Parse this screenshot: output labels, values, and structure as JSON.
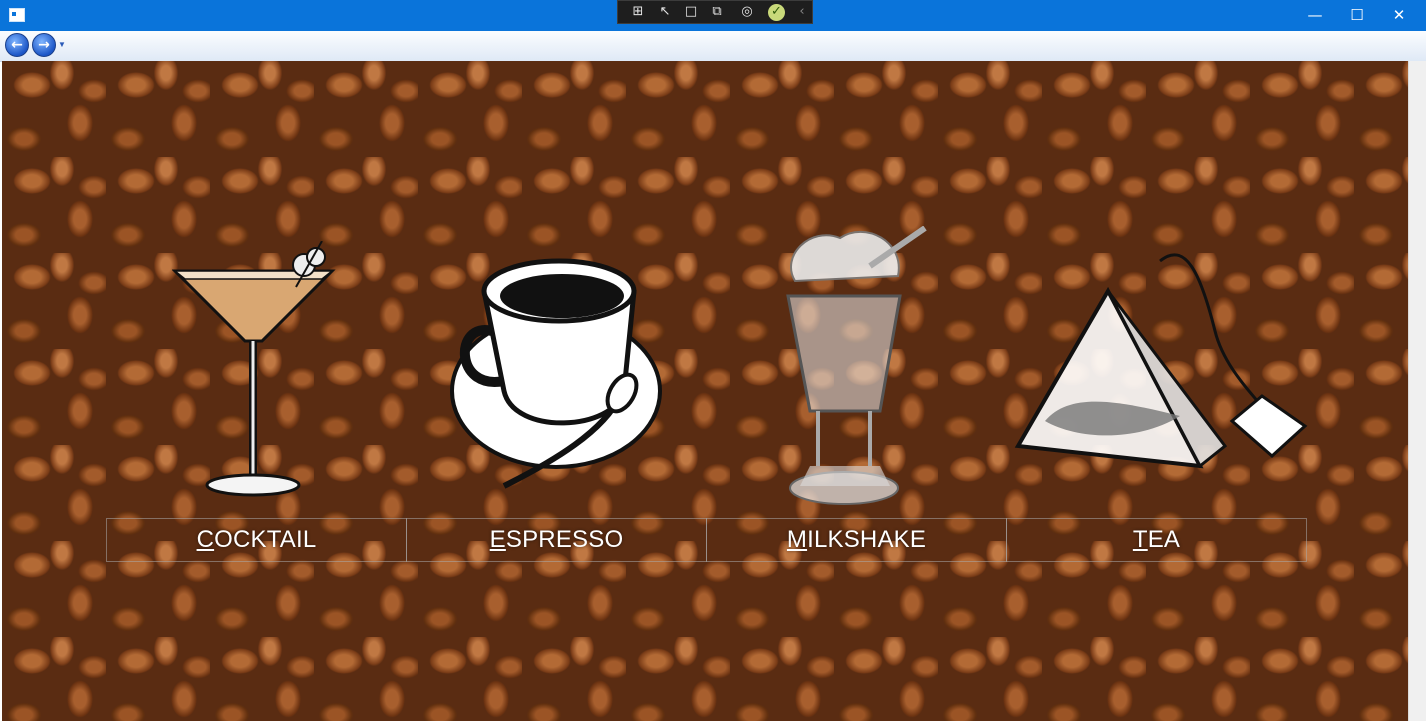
{
  "window": {
    "minimize_glyph": "—",
    "maximize_glyph": "☐",
    "close_glyph": "✕"
  },
  "devtools": [
    "select-icon",
    "pointer-icon",
    "frame-icon",
    "adorner-icon",
    "track-icon",
    "check-icon",
    "collapse-icon"
  ],
  "nav": {
    "back_glyph": "←",
    "forward_glyph": "→",
    "dropdown_glyph": "▼"
  },
  "drinks": [
    {
      "key": "C",
      "rest": "OCKTAIL",
      "icon": "cocktail-glass-icon"
    },
    {
      "key": "E",
      "rest": "SPRESSO",
      "icon": "coffee-cup-icon"
    },
    {
      "key": "M",
      "rest": "ILKSHAKE",
      "icon": "milkshake-glass-icon"
    },
    {
      "key": "T",
      "rest": "EA",
      "icon": "tea-bag-icon"
    }
  ],
  "colors": {
    "titlebar": "#0a74da",
    "background": "#5a2c12",
    "choice_text": "#ffffff"
  }
}
